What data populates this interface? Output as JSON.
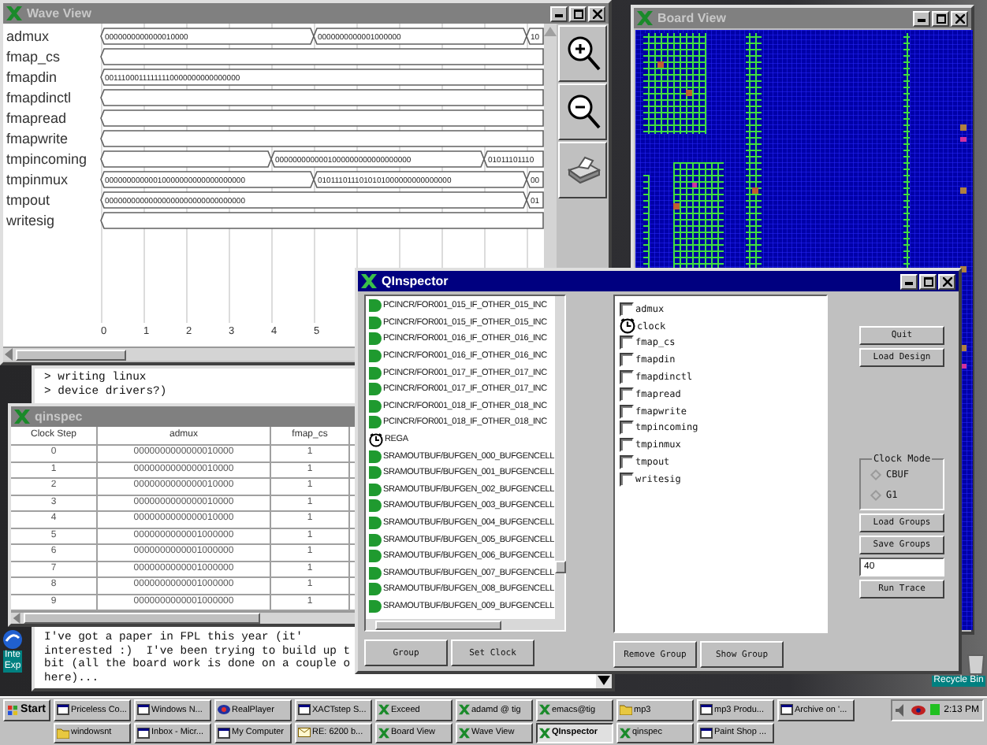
{
  "wave_view": {
    "title": "Wave View",
    "signals": [
      {
        "name": "admux",
        "segments": [
          {
            "kind": "value",
            "value": "0000000000000010000"
          },
          {
            "kind": "value",
            "value": "0000000000001000000"
          },
          {
            "kind": "value",
            "value": "10"
          }
        ]
      },
      {
        "name": "fmap_cs",
        "segments": [
          {
            "kind": "blank"
          }
        ]
      },
      {
        "name": "fmapdin",
        "segments": [
          {
            "kind": "value",
            "value": "00111000111111110000000000000000"
          }
        ]
      },
      {
        "name": "fmapdinctl",
        "segments": [
          {
            "kind": "blank"
          }
        ]
      },
      {
        "name": "fmapread",
        "segments": [
          {
            "kind": "blank"
          }
        ]
      },
      {
        "name": "fmapwrite",
        "segments": [
          {
            "kind": "blank"
          }
        ]
      },
      {
        "name": "tmpincoming",
        "segments": [
          {
            "kind": "blank"
          },
          {
            "kind": "value",
            "value": "0000000000001000000000000000000"
          },
          {
            "kind": "value",
            "value": "01011101110"
          }
        ]
      },
      {
        "name": "tmpinmux",
        "segments": [
          {
            "kind": "value",
            "value": "00000000000010000000000000000000"
          },
          {
            "kind": "value",
            "value": "0101110111010101000000000000000"
          },
          {
            "kind": "value",
            "value": "00"
          }
        ]
      },
      {
        "name": "tmpout",
        "segments": [
          {
            "kind": "value",
            "value": "00000000000000000000000000000000"
          },
          {
            "kind": "value",
            "value": "01"
          }
        ]
      },
      {
        "name": "writesig",
        "segments": [
          {
            "kind": "blank"
          }
        ]
      }
    ],
    "time_ticks": [
      "0",
      "1",
      "2",
      "3",
      "4",
      "5"
    ]
  },
  "board_view": {
    "title": "Board View"
  },
  "email": {
    "quoted_lines": [
      "> writing linux",
      "> device drivers?)"
    ],
    "body_lines": [
      "I've got a paper in FPL this year (it'",
      "interested :)  I've been trying to build up t",
      "bit (all the board work is done on a couple o",
      "here)..."
    ]
  },
  "qinspec": {
    "title": "qinspec",
    "columns": [
      "Clock Step",
      "admux",
      "fmap_cs"
    ],
    "rows": [
      [
        "0",
        "0000000000000010000",
        "1"
      ],
      [
        "1",
        "0000000000000010000",
        "1"
      ],
      [
        "2",
        "0000000000000010000",
        "1"
      ],
      [
        "3",
        "0000000000000010000",
        "1"
      ],
      [
        "4",
        "0000000000000010000",
        "1"
      ],
      [
        "5",
        "0000000000001000000",
        "1"
      ],
      [
        "6",
        "0000000000001000000",
        "1"
      ],
      [
        "7",
        "0000000000001000000",
        "1"
      ],
      [
        "8",
        "0000000000001000000",
        "1"
      ],
      [
        "9",
        "0000000000001000000",
        "1"
      ]
    ]
  },
  "qinspector": {
    "title": "QInspector",
    "cells": [
      {
        "kind": "cell",
        "label": "PCINCR/FOR001_015_IF_OTHER_015_INC"
      },
      {
        "kind": "cell",
        "label": "PCINCR/FOR001_015_IF_OTHER_015_INC"
      },
      {
        "kind": "cell",
        "label": "PCINCR/FOR001_016_IF_OTHER_016_INC"
      },
      {
        "kind": "cell",
        "label": "PCINCR/FOR001_016_IF_OTHER_016_INC"
      },
      {
        "kind": "cell",
        "label": "PCINCR/FOR001_017_IF_OTHER_017_INC"
      },
      {
        "kind": "cell",
        "label": "PCINCR/FOR001_017_IF_OTHER_017_INC"
      },
      {
        "kind": "cell",
        "label": "PCINCR/FOR001_018_IF_OTHER_018_INC"
      },
      {
        "kind": "cell",
        "label": "PCINCR/FOR001_018_IF_OTHER_018_INC"
      },
      {
        "kind": "clock",
        "label": "REGA"
      },
      {
        "kind": "cell",
        "label": "SRAMOUTBUF/BUFGEN_000_BUFGENCELL"
      },
      {
        "kind": "cell",
        "label": "SRAMOUTBUF/BUFGEN_001_BUFGENCELL"
      },
      {
        "kind": "cell",
        "label": "SRAMOUTBUF/BUFGEN_002_BUFGENCELL"
      },
      {
        "kind": "cell",
        "label": "SRAMOUTBUF/BUFGEN_003_BUFGENCELL"
      },
      {
        "kind": "cell",
        "label": "SRAMOUTBUF/BUFGEN_004_BUFGENCELL"
      },
      {
        "kind": "cell",
        "label": "SRAMOUTBUF/BUFGEN_005_BUFGENCELL"
      },
      {
        "kind": "cell",
        "label": "SRAMOUTBUF/BUFGEN_006_BUFGENCELL"
      },
      {
        "kind": "cell",
        "label": "SRAMOUTBUF/BUFGEN_007_BUFGENCELL"
      },
      {
        "kind": "cell",
        "label": "SRAMOUTBUF/BUFGEN_008_BUFGENCELL"
      },
      {
        "kind": "cell",
        "label": "SRAMOUTBUF/BUFGEN_009_BUFGENCELL"
      }
    ],
    "signals": [
      {
        "kind": "checkbox",
        "label": "admux",
        "checked": false
      },
      {
        "kind": "clock",
        "label": "clock"
      },
      {
        "kind": "checkbox",
        "label": "fmap_cs",
        "checked": false
      },
      {
        "kind": "checkbox",
        "label": "fmapdin",
        "checked": false
      },
      {
        "kind": "checkbox",
        "label": "fmapdinctl",
        "checked": false
      },
      {
        "kind": "checkbox",
        "label": "fmapread",
        "checked": false
      },
      {
        "kind": "checkbox",
        "label": "fmapwrite",
        "checked": false
      },
      {
        "kind": "checkbox",
        "label": "tmpincoming",
        "checked": false
      },
      {
        "kind": "checkbox",
        "label": "tmpinmux",
        "checked": false
      },
      {
        "kind": "checkbox",
        "label": "tmpout",
        "checked": false
      },
      {
        "kind": "checkbox",
        "label": "writesig",
        "checked": false
      }
    ],
    "quit_button": "Quit",
    "load_design_button": "Load Design",
    "clock_mode": {
      "label": "Clock Mode",
      "options": [
        {
          "label": "CBUF",
          "selected": false
        },
        {
          "label": "G1",
          "selected": false
        }
      ]
    },
    "load_groups_button": "Load Groups",
    "save_groups_button": "Save Groups",
    "trace_steps": "40",
    "run_trace_button": "Run Trace",
    "left_buttons": [
      "Group",
      "Set Clock"
    ],
    "right_buttons": [
      "Remove Group",
      "Show Group"
    ]
  },
  "desktop_icons": [
    {
      "kind": "browser",
      "lines": [
        "Inte",
        "Exp"
      ]
    },
    {
      "kind": "recycle",
      "lines": [
        "Recycle Bin"
      ]
    }
  ],
  "taskbar": {
    "start": "Start",
    "clock": "2:13 PM",
    "rows": [
      [
        {
          "label": "Priceless Co...",
          "kind": "window",
          "selected": false
        },
        {
          "label": "Windows N...",
          "kind": "window",
          "selected": false
        },
        {
          "label": "RealPlayer",
          "kind": "player",
          "selected": false
        },
        {
          "label": "XACTstep S...",
          "kind": "window",
          "selected": false
        },
        {
          "label": "Exceed",
          "kind": "x",
          "selected": false
        },
        {
          "label": "adamd @ tig",
          "kind": "x",
          "selected": false
        },
        {
          "label": "emacs@tig",
          "kind": "x",
          "selected": false
        },
        {
          "label": "mp3",
          "kind": "folder",
          "selected": false
        },
        {
          "label": "mp3 Produ...",
          "kind": "window",
          "selected": false
        },
        {
          "label": "Archive on '...",
          "kind": "window",
          "selected": false
        }
      ],
      [
        {
          "label": "windowsnt",
          "kind": "folder",
          "selected": false
        },
        {
          "label": "Inbox - Micr...",
          "kind": "window",
          "selected": false
        },
        {
          "label": "My Computer",
          "kind": "window",
          "selected": false
        },
        {
          "label": "RE: 6200 b...",
          "kind": "mail",
          "selected": false
        },
        {
          "label": "Board View",
          "kind": "x",
          "selected": false
        },
        {
          "label": "Wave View",
          "kind": "x",
          "selected": false
        },
        {
          "label": "QInspector",
          "kind": "x",
          "selected": true
        },
        {
          "label": "qinspec",
          "kind": "x",
          "selected": false
        },
        {
          "label": "Paint Shop ...",
          "kind": "window",
          "selected": false
        }
      ]
    ]
  }
}
